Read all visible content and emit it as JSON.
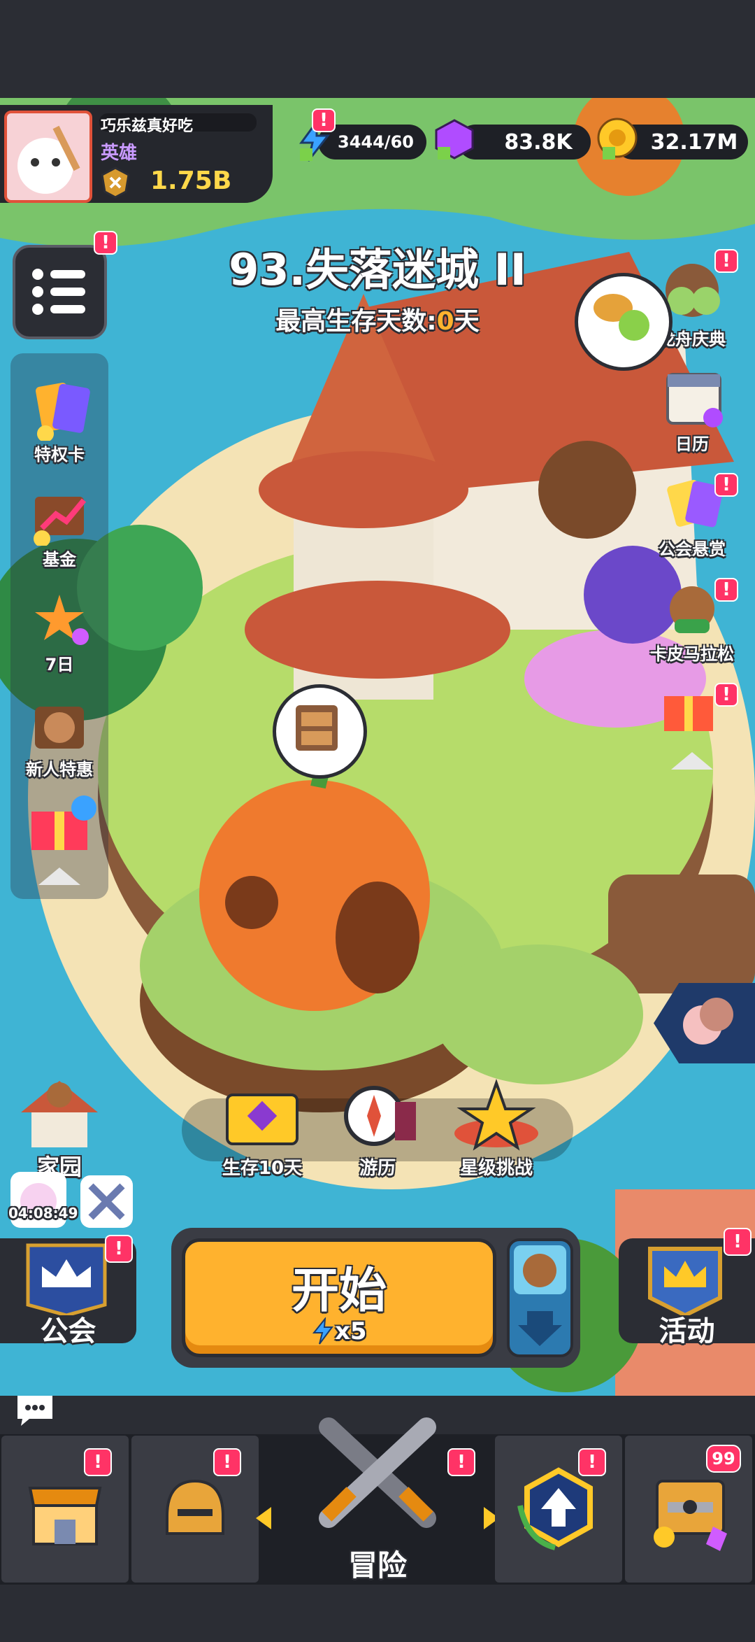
{
  "player": {
    "name": "巧乐兹真好吃",
    "title": "英雄",
    "power": "1.75B"
  },
  "currencies": {
    "energy": "3444/60",
    "gems": "83.8K",
    "coins": "32.17M"
  },
  "stage": {
    "title": "93.失落迷城 II",
    "survival_label": "最高生存天数:",
    "survival_days": "0",
    "survival_unit": "天"
  },
  "left_side": [
    {
      "label": "特权卡"
    },
    {
      "label": "基金"
    },
    {
      "label": "7日"
    },
    {
      "label": "新人特惠"
    }
  ],
  "right_side": [
    {
      "label": "龙舟庆典"
    },
    {
      "label": "日历"
    },
    {
      "label": "公会悬赏"
    },
    {
      "label": "卡皮马拉松"
    }
  ],
  "home": {
    "label": "家园",
    "timer": "04:08:49"
  },
  "tasks": [
    {
      "label": "生存10天"
    },
    {
      "label": "游历"
    },
    {
      "label": "星级挑战"
    }
  ],
  "guild": {
    "label": "公会"
  },
  "start": {
    "label": "开始",
    "cost": "x5"
  },
  "activity": {
    "label": "活动"
  },
  "nav": {
    "adventure": "冒险",
    "chest_count": "99"
  },
  "colors": {
    "start": "#ffb22e",
    "badge": "#ff3366",
    "gold": "#ffd84a",
    "gem": "#b04cff"
  }
}
